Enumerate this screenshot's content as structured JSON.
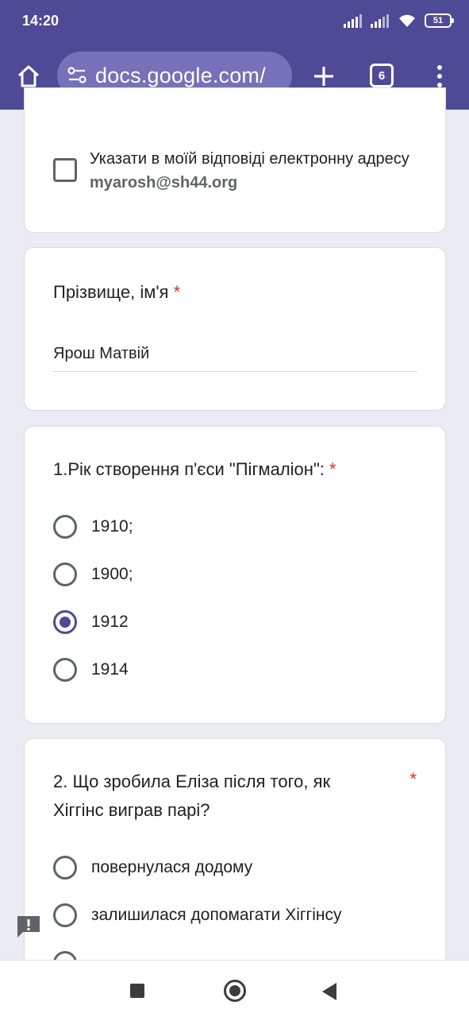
{
  "status_bar": {
    "time": "14:20",
    "battery": "51"
  },
  "browser": {
    "url": "docs.google.com/",
    "tab_count": "6",
    "icons": [
      "home-icon",
      "site-settings-icon",
      "new-tab-plus-icon",
      "tab-switcher-icon",
      "overflow-menu-icon"
    ],
    "accent_color": "#4f4a96"
  },
  "form": {
    "email_option": {
      "label_prefix": "Указати в моїй відповіді електронну адресу ",
      "email": "myarosh@sh44.org"
    },
    "name_question": {
      "title": "Прізвище, ім'я",
      "required_mark": "*",
      "answer": "Ярош Матвій"
    },
    "question1": {
      "title": "1.Рік створення п'єси \"Пігмаліон\":",
      "required_mark": "*",
      "options": [
        {
          "label": "1910;",
          "selected": false
        },
        {
          "label": "1900;",
          "selected": false
        },
        {
          "label": "1912",
          "selected": true
        },
        {
          "label": "1914",
          "selected": false
        }
      ]
    },
    "question2": {
      "title_line1": "2. Що зробила Еліза після того, як",
      "title_line2": "Хіггінс виграв парі?",
      "required_mark": "*",
      "options": [
        {
          "label": "повернулася додому"
        },
        {
          "label": "залишилася допомагати Хіггінсу"
        }
      ]
    }
  },
  "required_color": "#d93025"
}
